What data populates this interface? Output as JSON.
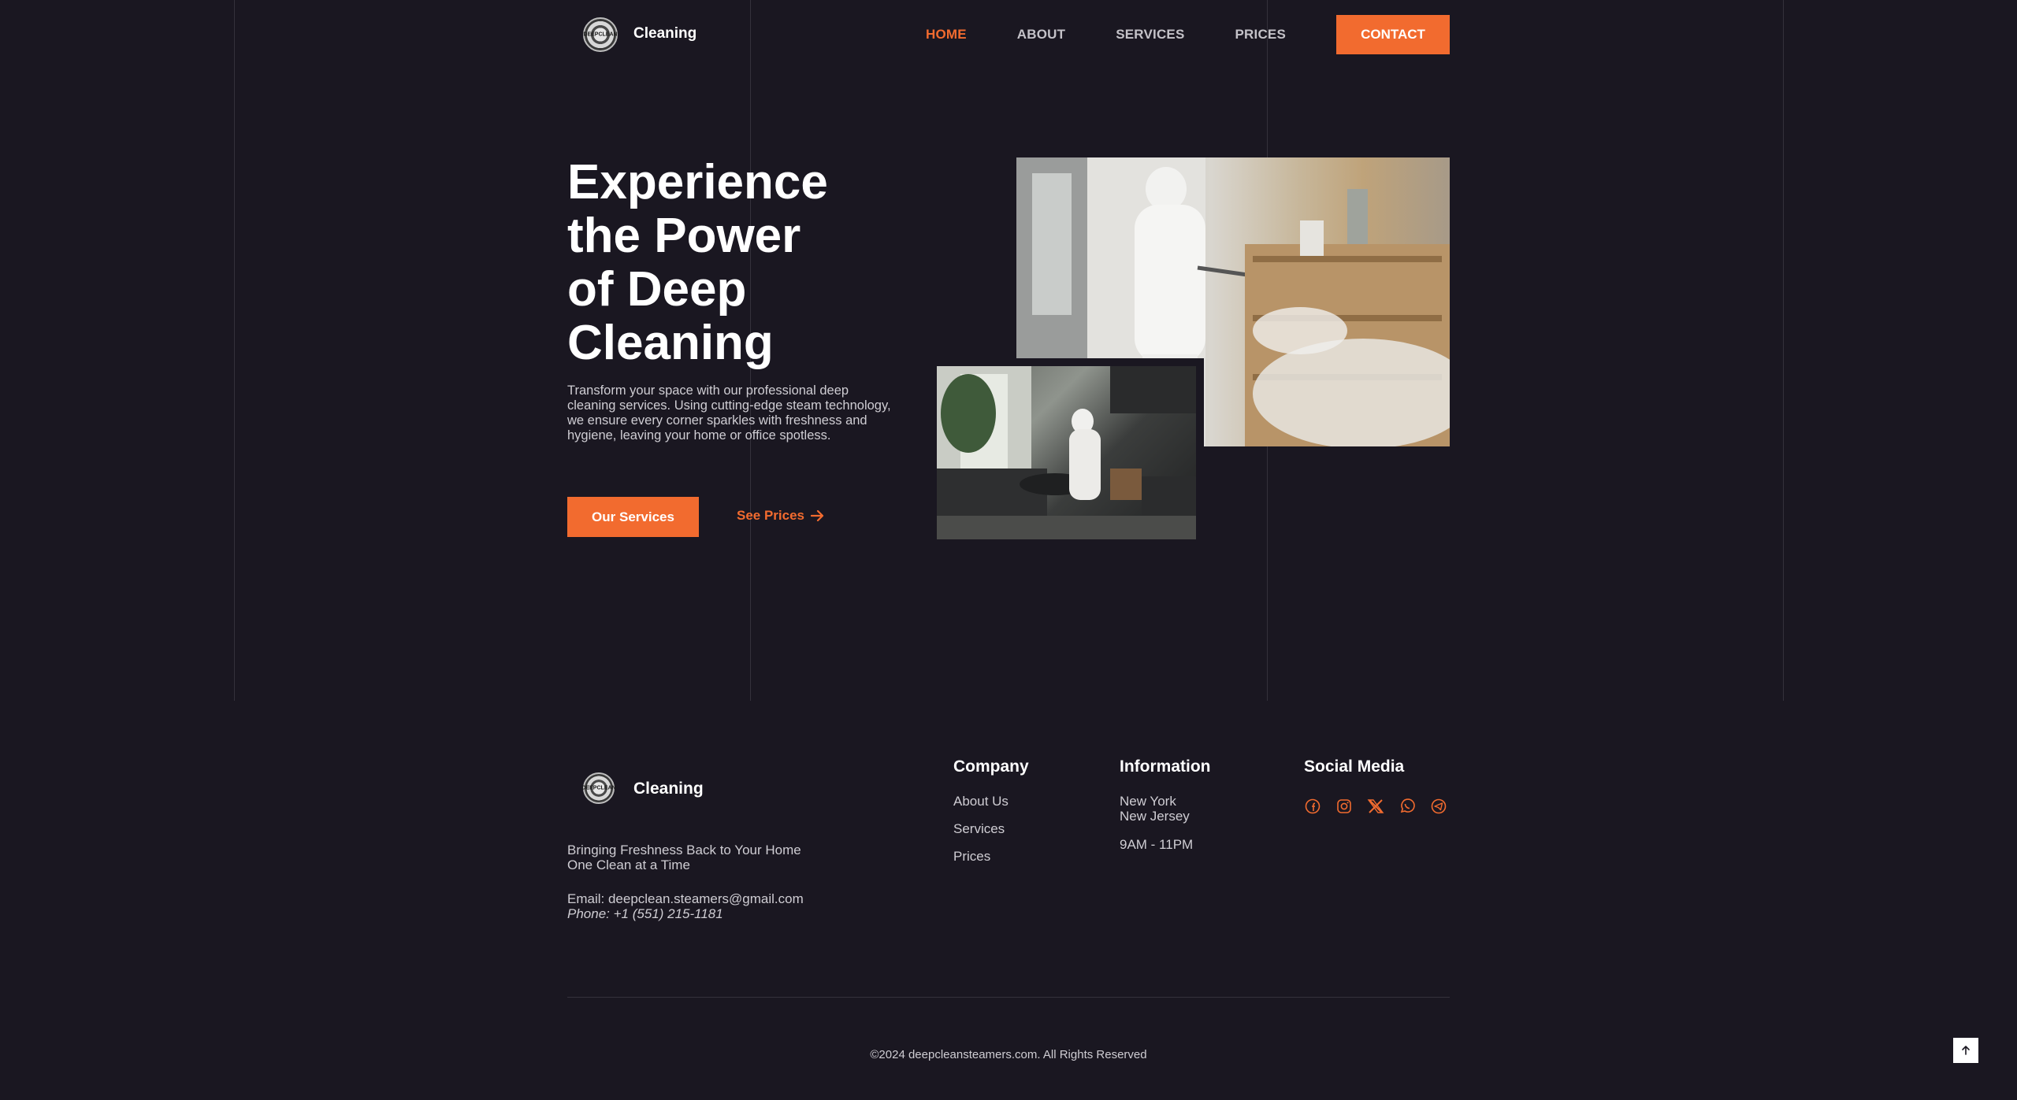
{
  "header": {
    "logo_text": "DEEPCLEAN",
    "brand": "Cleaning",
    "nav": [
      {
        "label": "HOME",
        "active": true
      },
      {
        "label": "ABOUT",
        "active": false
      },
      {
        "label": "SERVICES",
        "active": false
      },
      {
        "label": "PRICES",
        "active": false
      }
    ],
    "contact_label": "CONTACT"
  },
  "hero": {
    "title_lines": [
      "Experience",
      "the Power",
      "of Deep",
      "Cleaning"
    ],
    "description": "Transform your space with our professional deep cleaning services. Using cutting-edge steam technology, we ensure every corner sparkles with freshness and hygiene, leaving your home or office spotless.",
    "primary_button": "Our Services",
    "secondary_button": "See Prices",
    "secondary_icon": "arrow-right-icon"
  },
  "footer": {
    "brand": "Cleaning",
    "tagline_lines": [
      "Bringing Freshness Back to Your Home",
      "One Clean at a Time"
    ],
    "email": "Email: deepclean.steamers@gmail.com",
    "phone": "Phone: +1 (551) 215-1181",
    "company": {
      "title": "Company",
      "links": [
        "About Us",
        "Services",
        "Prices"
      ]
    },
    "information": {
      "title": "Information",
      "city1": "New York",
      "city2": "New Jersey",
      "hours": "9AM - 11PM"
    },
    "social": {
      "title": "Social Media",
      "icons": [
        "facebook-icon",
        "instagram-icon",
        "x-icon",
        "whatsapp-icon",
        "telegram-icon"
      ]
    },
    "copyright": "©2024 deepcleansteamers.com. All Rights Reserved"
  },
  "colors": {
    "accent": "#f26b2f",
    "background": "#1a1721"
  }
}
